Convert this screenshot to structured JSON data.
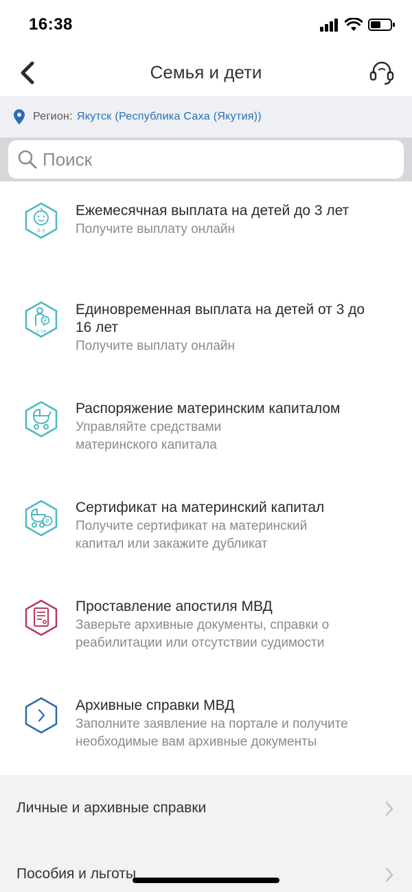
{
  "status_bar": {
    "time": "16:38"
  },
  "nav": {
    "title": "Семья и дети"
  },
  "region": {
    "label": "Регион:",
    "value": "Якутск (Республика Саха (Якутия))"
  },
  "search": {
    "placeholder": "Поиск"
  },
  "services": [
    {
      "title": "Ежемесячная выплата на детей до 3 лет",
      "subtitle": "Получите выплату онлайн",
      "icon": "baby-0-3-icon"
    },
    {
      "title_line1": "Единовременная выплата на детей от 3 до",
      "title_line2": "16 лет",
      "subtitle": "Получите выплату онлайн",
      "icon": "child-3-16-icon"
    },
    {
      "title": "Распоряжение материнским капиталом",
      "subtitle_line1": "Управляйте средствами",
      "subtitle_line2": "материнского капитала",
      "icon": "stroller-icon"
    },
    {
      "title": "Сертификат на материнский капитал",
      "subtitle_line1": "Получите сертификат на материнский",
      "subtitle_line2": "капитал или закажите дубликат",
      "icon": "stroller-ruble-icon"
    },
    {
      "title": "Проставление апостиля МВД",
      "subtitle_line1": "Заверьте архивные документы, справки о",
      "subtitle_line2": "реабилитации или отсутствии судимости",
      "icon": "document-stamp-icon"
    },
    {
      "title": "Архивные справки МВД",
      "subtitle_line1": "Заполните заявление на портале и получите",
      "subtitle_line2": "необходимые вам архивные документы",
      "icon": "chevron-right-hex-icon"
    }
  ],
  "categories": [
    {
      "label": "Личные и архивные справки"
    },
    {
      "label": "Пособия и льготы"
    }
  ],
  "colors": {
    "teal": "#4bb8c4",
    "crimson": "#b7395b",
    "blue": "#2e68ad",
    "link": "#2a6db5"
  }
}
